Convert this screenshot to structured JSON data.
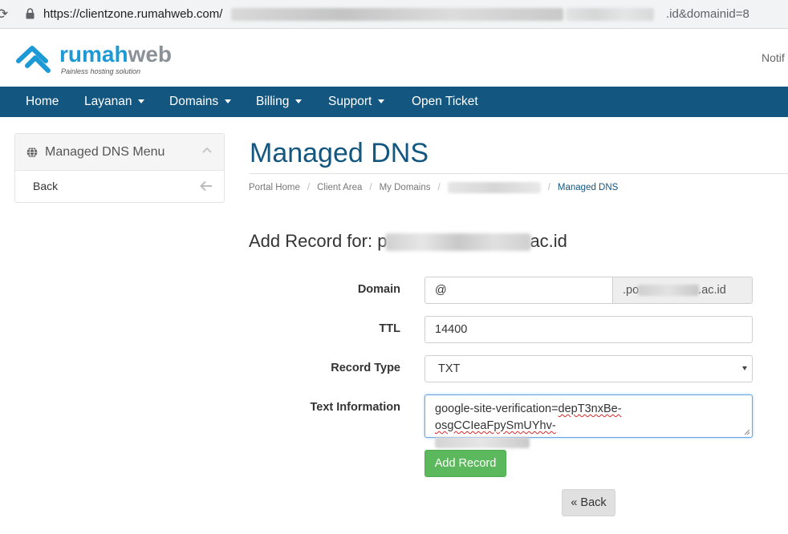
{
  "browser": {
    "url_prefix": "https://clientzone.rumahweb.com/",
    "url_suffix": ".id&domainid=8"
  },
  "header": {
    "logo_text_a": "rumah",
    "logo_text_b": "web",
    "logo_tagline": "Painless hosting solution",
    "notifications_label": "Notif"
  },
  "nav": {
    "items": [
      {
        "label": "Home"
      },
      {
        "label": "Layanan"
      },
      {
        "label": "Domains"
      },
      {
        "label": "Billing"
      },
      {
        "label": "Support"
      },
      {
        "label": "Open Ticket"
      }
    ]
  },
  "sidebar": {
    "title": "Managed DNS Menu",
    "back_label": "Back"
  },
  "main": {
    "page_title": "Managed DNS",
    "breadcrumb": {
      "portal_home": "Portal Home",
      "client_area": "Client Area",
      "my_domains": "My Domains",
      "current": "Managed DNS"
    },
    "add_title_prefix": "Add Record for: p",
    "add_title_suffix": "ac.id"
  },
  "form": {
    "domain_label": "Domain",
    "domain_value": "@",
    "domain_addon_prefix": ".po",
    "domain_addon_suffix": ".ac.id",
    "ttl_label": "TTL",
    "ttl_value": "14400",
    "record_type_label": "Record Type",
    "record_type_value": "TXT",
    "text_info_label": "Text Information",
    "text_info_prefix": "google-site-verification=",
    "text_info_token": "depT3nxBe-osgCCIeaFpySmUYhv-",
    "add_record_button": "Add Record",
    "back_button": "« Back"
  },
  "colors": {
    "nav_bg": "#13567f",
    "title_color": "#13567f",
    "logo_blue": "#1d9ad6",
    "add_button_green": "#5cb85c"
  }
}
